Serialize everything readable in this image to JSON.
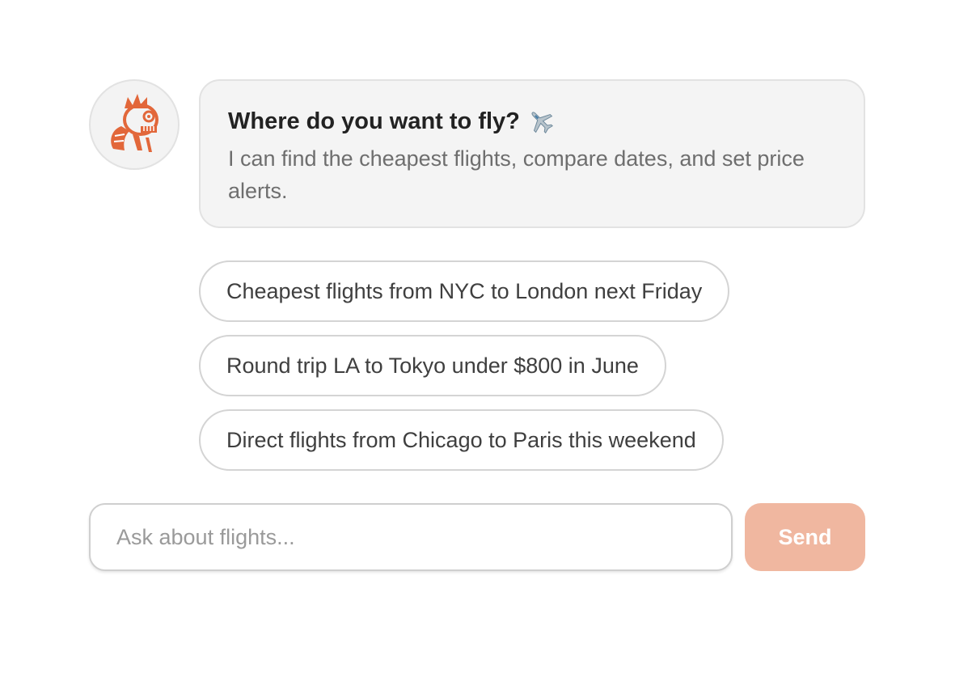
{
  "assistant": {
    "avatar_icon": "zombie-mascot-icon",
    "brand_color": "#e2673a",
    "title": "Where do you want to fly?",
    "title_icon": "airplane-icon",
    "description": "I can find the cheapest flights, compare dates, and set price alerts."
  },
  "suggestions": [
    {
      "label": "Cheapest flights from NYC to London next Friday"
    },
    {
      "label": "Round trip LA to Tokyo under $800 in June"
    },
    {
      "label": "Direct flights from Chicago to Paris this weekend"
    }
  ],
  "composer": {
    "placeholder": "Ask about flights...",
    "value": "",
    "send_label": "Send",
    "send_color": "#f0b7a0"
  }
}
